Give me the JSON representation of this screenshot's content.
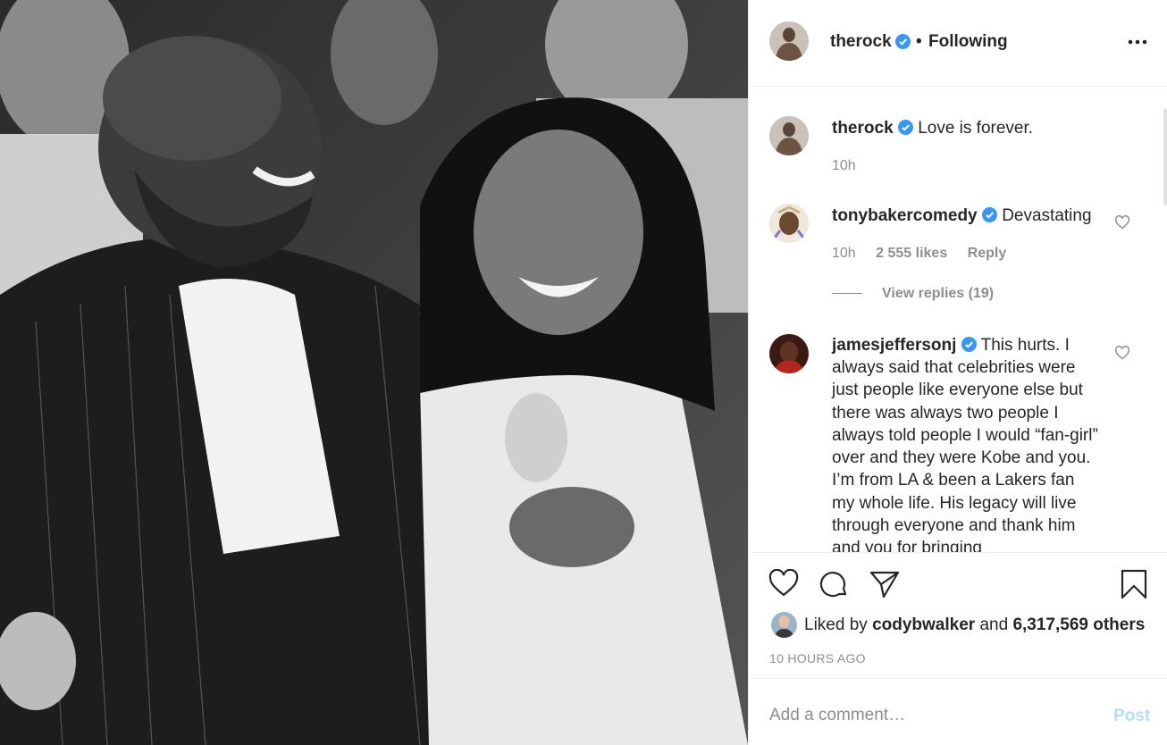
{
  "post": {
    "author": "therock",
    "follow_separator": "•",
    "follow_status": "Following",
    "more_icon": "more-options-icon",
    "image_alt": "Black and white photo of a smiling man and girl sitting courtside"
  },
  "caption": {
    "username": "therock",
    "text": "Love is forever.",
    "time": "10h"
  },
  "comments": [
    {
      "username": "tonybakercomedy",
      "text": "Devastating",
      "time": "10h",
      "likes": "2 555 likes",
      "reply_label": "Reply",
      "view_replies": "View replies (19)"
    },
    {
      "username": "jamesjeffersonj",
      "text_first": "This hurts. I",
      "text_rest": "always said that celebrities were just people like everyone else but there was always two people I always told people I would “fan-girl” over and they were Kobe and you. I’m from LA & been a Lakers fan my whole life. His legacy will live through everyone and thank him and you for bringing"
    }
  ],
  "actions": {
    "like_icon": "heart-icon",
    "comment_icon": "comment-icon",
    "share_icon": "share-icon",
    "save_icon": "bookmark-icon"
  },
  "likes": {
    "prefix": "Liked by",
    "user": "codybwalker",
    "conjunction": "and",
    "others": "6,317,569 others"
  },
  "timestamp": "10 HOURS AGO",
  "add_comment": {
    "placeholder": "Add a comment…",
    "post_label": "Post"
  },
  "colors": {
    "verified": "#3897f0",
    "muted": "#8e8e8e",
    "post_disabled": "#b2dffc"
  }
}
